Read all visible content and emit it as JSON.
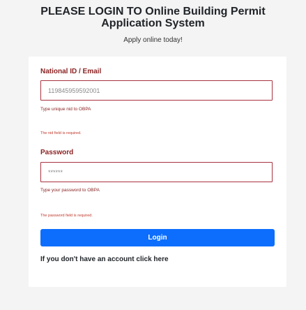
{
  "header": {
    "title": "PLEASE LOGIN TO Online Building Permit Application System",
    "tagline": "Apply online today!"
  },
  "form": {
    "nid": {
      "label": "National ID / Email",
      "value": "119845959592001",
      "help": "Type unique nid to OBPA",
      "error": "The nid field is required."
    },
    "password": {
      "label": "Password",
      "value": "******",
      "help": "Type your password to OBPA",
      "error": "The password field is required."
    },
    "login_label": "Login",
    "register_link": "If you don't have an account click here"
  },
  "colors": {
    "accent": "#0d6efd",
    "error": "#a8323e",
    "background": "#f4f4f4",
    "card": "#ffffff"
  }
}
